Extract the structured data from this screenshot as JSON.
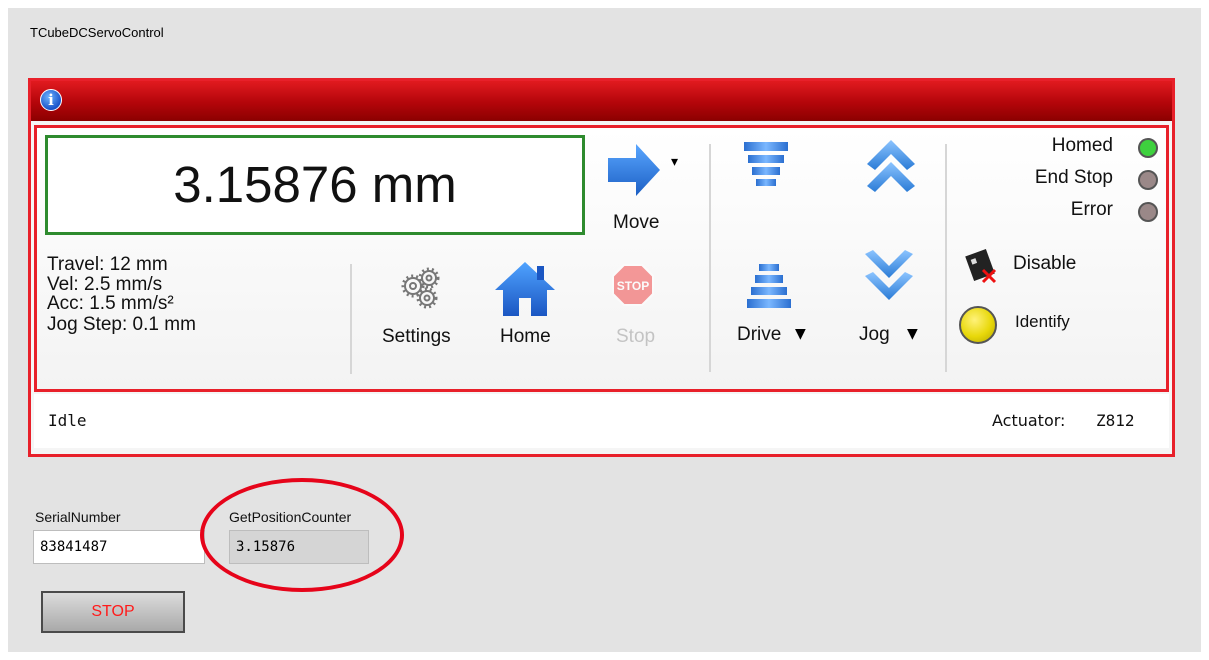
{
  "window": {
    "title": "TCubeDCServoControl"
  },
  "position": {
    "value": "3.15876 mm"
  },
  "params": {
    "travel": "Travel: 12 mm",
    "vel": "Vel: 2.5 mm/s",
    "acc": "Acc: 1.5 mm/s²",
    "jog_step": "Jog Step: 0.1 mm"
  },
  "toolbar": {
    "move_label": "Move",
    "settings_label": "Settings",
    "home_label": "Home",
    "stop_label": "Stop",
    "stop_sign_text": "STOP",
    "drive_label": "Drive",
    "jog_label": "Jog"
  },
  "status": {
    "homed": "Homed",
    "end_stop": "End Stop",
    "error": "Error",
    "disable": "Disable",
    "identify": "Identify",
    "colors": {
      "homed_led": "#3ed13e",
      "off_led": "#9a8888",
      "identify_led": "#e8d80a"
    }
  },
  "statusbar": {
    "state": "Idle",
    "actuator_label": "Actuator:",
    "actuator_value": "Z812"
  },
  "serial": {
    "label": "SerialNumber",
    "value": "83841487"
  },
  "counter": {
    "label": "GetPositionCounter",
    "value": "3.15876"
  },
  "stop_button": {
    "label": "STOP"
  },
  "icons": [
    "info-icon",
    "move-arrow-icon",
    "settings-gears-icon",
    "home-icon",
    "stop-sign-icon",
    "drive-up-icon",
    "drive-down-icon",
    "jog-up-icon",
    "jog-down-icon",
    "disable-icon"
  ],
  "accent_colors": {
    "frame_red": "#e8202a",
    "position_border": "#2e8b2e",
    "icon_blue": "#2a7bd6"
  }
}
